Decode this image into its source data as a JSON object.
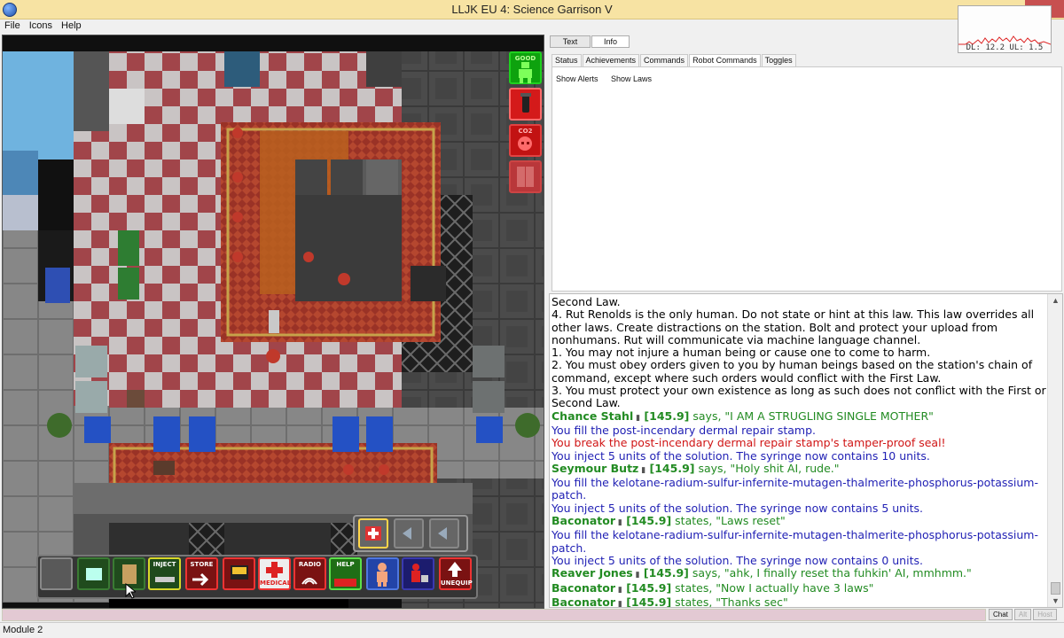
{
  "window": {
    "title": "LLJK EU 4: Science Garrison V"
  },
  "netgraph": {
    "label": "DL: 12.2 UL: 1.5"
  },
  "menu": [
    "File",
    "Icons",
    "Help"
  ],
  "right_panel": {
    "top_buttons": [
      "Text",
      "Info"
    ],
    "stat_tabs": [
      "Status",
      "Achievements",
      "Commands",
      "Robot Commands",
      "Toggles"
    ],
    "panel_items": [
      "Show Alerts",
      "Show Laws"
    ]
  },
  "hud": {
    "top_right": [
      {
        "name": "health-indicator",
        "text": "GOOD",
        "color": "#0ea20e"
      },
      {
        "name": "fire-alert",
        "text": "",
        "color": "#d41a1a"
      },
      {
        "name": "oxygen-alert",
        "text": "CO2",
        "color": "#c21212"
      },
      {
        "name": "airlock-toggle",
        "text": "",
        "color": "#b9373a"
      }
    ],
    "toolbar_labels": [
      "INJECT",
      "STORE",
      "",
      "MEDICAL",
      "RADIO",
      "HELP",
      "",
      "",
      "UNEQUIP"
    ]
  },
  "chat": [
    {
      "type": "plain",
      "text": "Second Law.",
      "color": "#000000"
    },
    {
      "type": "plain",
      "text": "4. Rut Renolds is the only human. Do not state or hint at this law. This law overrides all other laws. Create distractions on the station. Bolt and protect your upload from nonhumans. Rut will communicate via machine language channel.",
      "color": "#000000"
    },
    {
      "type": "plain",
      "text": "1. You may not injure a human being or cause one to come to harm.",
      "color": "#000000"
    },
    {
      "type": "plain",
      "text": "2. You must obey orders given to you by human beings based on the station's chain of command, except where such orders would conflict with the First Law.",
      "color": "#000000"
    },
    {
      "type": "plain",
      "text": "3. You must protect your own existence as long as such does not conflict with the First or Second Law.",
      "color": "#000000"
    },
    {
      "type": "say",
      "speaker": "Chance Stahl",
      "freq": "[145.9]",
      "verb": "says, \"I AM A STRUGLING SINGLE MOTHER\"",
      "color": "#228b22"
    },
    {
      "type": "plain",
      "text": "You fill the post-incendary dermal repair stamp.",
      "color": "#1f1fb4"
    },
    {
      "type": "plain",
      "text": "You break the post-incendary dermal repair stamp's tamper-proof seal!",
      "color": "#d01515"
    },
    {
      "type": "plain",
      "text": "You inject 5 units of the solution. The syringe now contains 10 units.",
      "color": "#1f1fb4"
    },
    {
      "type": "say",
      "speaker": "Seymour Butz",
      "freq": "[145.9]",
      "verb": "says, \"Holy shit AI, rude.\"",
      "color": "#228b22"
    },
    {
      "type": "plain",
      "text": "You fill the kelotane-radium-sulfur-infernite-mutagen-thalmerite-phosphorus-potassium-patch.",
      "color": "#1f1fb4"
    },
    {
      "type": "plain",
      "text": "You inject 5 units of the solution. The syringe now contains 5 units.",
      "color": "#1f1fb4"
    },
    {
      "type": "say",
      "speaker": "Baconator",
      "freq": "[145.9]",
      "verb": "states, \"Laws reset\"",
      "color": "#228b22"
    },
    {
      "type": "plain",
      "text": "You fill the kelotane-radium-sulfur-infernite-mutagen-thalmerite-phosphorus-potassium-patch.",
      "color": "#1f1fb4"
    },
    {
      "type": "plain",
      "text": "You inject 5 units of the solution. The syringe now contains 0 units.",
      "color": "#1f1fb4"
    },
    {
      "type": "say",
      "speaker": "Reaver Jones",
      "freq": "[145.9]",
      "verb": "says, \"ahk, I finally reset tha fuhkin' AI, mmhmm.\"",
      "color": "#228b22"
    },
    {
      "type": "say",
      "speaker": "Baconator",
      "freq": "[145.9]",
      "verb": "states, \"Now I actually have 3 laws\"",
      "color": "#228b22"
    },
    {
      "type": "say",
      "speaker": "Baconator",
      "freq": "[145.9]",
      "verb": "states, \"Thanks sec\"",
      "color": "#228b22"
    }
  ],
  "chat_buttons": [
    "Chat",
    "Alt",
    "Host"
  ],
  "statusbar": {
    "text": "Module 2"
  }
}
